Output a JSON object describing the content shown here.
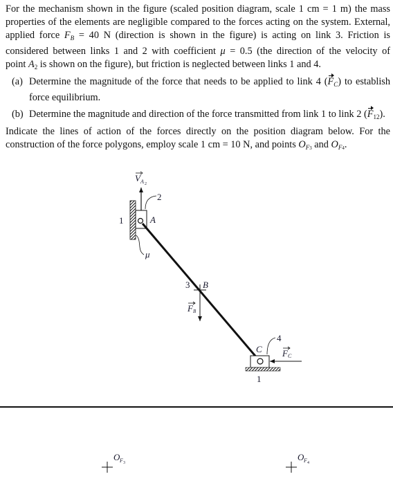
{
  "problem": {
    "intro_lines": [
      "For the mechanism shown in the figure (scaled position diagram, scale 1 cm = 1 m) the mass",
      "properties of the elements are negligible compared to the forces acting on the system. External,",
      [
        "applied force ",
        "F",
        "B",
        " = 40 N (direction is shown in the figure) is acting on link 3. Friction is"
      ],
      [
        "considered between links 1 and 2 with coefficient ",
        "μ",
        " = 0.5 (the direction of the velocity of"
      ],
      [
        "point ",
        "A",
        "2",
        " is shown on the figure), but friction is neglected between links 1 and 4."
      ]
    ],
    "intro": {
      "l1": "For the mechanism shown in the figure (scaled position diagram, scale 1 cm = 1 m) the mass",
      "l2": "properties of the elements are negligible compared to the forces acting on the system. External,",
      "l3a": "applied force ",
      "l3_sym": "F",
      "l3_sub": "B",
      "l3b": " = 40 N (direction is shown in the figure) is acting on link 3. Friction is",
      "l4a": "considered between links 1 and 2 with coefficient ",
      "l4_sym": "μ",
      "l4b": " = 0.5 (the direction of the velocity of",
      "l5a": "point ",
      "l5_sym": "A",
      "l5_sub": "2",
      "l5b": " is shown on the figure), but friction is neglected between links 1 and 4."
    },
    "parts": [
      {
        "label": "(a)",
        "l1a": "Determine the magnitude of the force that needs to be applied to link 4 (",
        "sym": "F",
        "sub": "C",
        "l1b": ") to establish",
        "l2": "force equilibrium."
      },
      {
        "label": "(b)",
        "l1a": "Determine the magnitude and direction of the force transmitted from link 1 to link 2 (",
        "sym": "F",
        "sub": "12",
        "l1b": ")."
      }
    ],
    "instructions": {
      "l1": "Indicate the lines of action of the forces directly on the position diagram below. For the",
      "l2a": "construction of the force polygons, employ scale 1 cm = 10 N, and points ",
      "o3_sym": "O",
      "o3_sub": "F",
      "o3_subsub": "3",
      "and": " and ",
      "o4_sym": "O",
      "o4_sub": "F",
      "o4_subsub": "4",
      "end": "."
    }
  },
  "diagram": {
    "labels": {
      "velocity": "V",
      "velocity_sub": "A",
      "velocity_subsub": "2",
      "link2": "2",
      "ground_left": "1",
      "point_a": "A",
      "friction": "μ",
      "link3": "3",
      "point_b": "B",
      "force_b": "F",
      "force_b_sub": "B",
      "link4": "4",
      "point_c": "C",
      "force_c": "F",
      "force_c_sub": "C",
      "ground_bottom": "1"
    }
  },
  "polygon_area": {
    "origin_f3": {
      "sym": "O",
      "sub": "F",
      "subsub": "3"
    },
    "origin_f4": {
      "sym": "O",
      "sub": "F",
      "subsub": "4"
    }
  }
}
